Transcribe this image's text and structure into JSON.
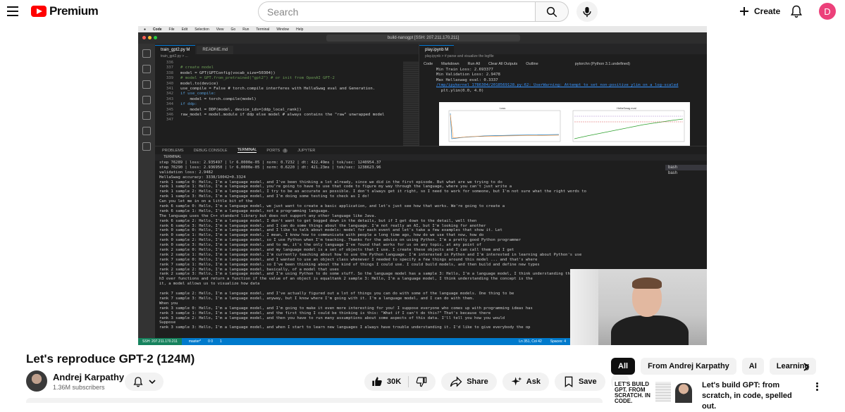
{
  "masthead": {
    "logo_text": "Premium",
    "search_placeholder": "Search",
    "create_label": "Create",
    "avatar_letter": "D",
    "colors": {
      "brand": "#ff0000",
      "avatar": "#ec407a"
    }
  },
  "video_frame": {
    "mac_menu": [
      "Code",
      "File",
      "Edit",
      "Selection",
      "View",
      "Go",
      "Run",
      "Terminal",
      "Window",
      "Help"
    ],
    "command_center": "build-nanogpt [SSH: 207.211.170.211]",
    "editor_tabs": [
      "train_gpt2.py M",
      "README.md"
    ],
    "editor_breadcrumb": "train_gpt2.py > ...",
    "code_lines": [
      {
        "n": "336",
        "t": ""
      },
      {
        "n": "337",
        "t": "# create model"
      },
      {
        "n": "338",
        "t": "model = GPT(GPTConfig(vocab_size=50304))"
      },
      {
        "n": "339",
        "t": "# model = GPT.from_pretrained(\"gpt2\") # or init from OpenAI GPT-2"
      },
      {
        "n": "340",
        "t": "model.to(device)"
      },
      {
        "n": "341",
        "t": "use_compile = False # torch.compile interferes with HellaSwag eval and Generation."
      },
      {
        "n": "342",
        "t": "if use_compile:"
      },
      {
        "n": "343",
        "t": "    model = torch.compile(model)"
      },
      {
        "n": "344",
        "t": "if ddp:"
      },
      {
        "n": "345",
        "t": "    model = DDP(model, device_ids=[ddp_local_rank])"
      },
      {
        "n": "346",
        "t": "raw_model = model.module if ddp else model # always contains the \"raw\" unwrapped model"
      },
      {
        "n": "347",
        "t": ""
      }
    ],
    "notebook_tab": "play.ipynb M",
    "notebook_breadcrumb": "play.ipynb > # parse and visualize the logfile",
    "notebook_toolbar": [
      "Code",
      "Markdown",
      "Run All",
      "Clear All Outputs",
      "Outline"
    ],
    "kernel": "pytorchn (Python 3.1.undefined)",
    "notebook_output": [
      "Min Train Loss: 2.693377",
      "Min Validation Loss: 2.9478",
      "Max Hellaswag eval: 0.3337",
      "/tmp/ipykernel_1786304/2018569128.py:62: UserWarning: Attempt to set non-positive ylim on a log-scaled",
      "  plt.ylim(0.0, 4.0)"
    ],
    "plot_titles": [
      "Loss",
      "HellaSwag eval"
    ],
    "panel_tabs": [
      "PROBLEMS",
      "DEBUG CONSOLE",
      "TERMINAL",
      "PORTS",
      "JUPYTER"
    ],
    "ports_count": "1",
    "terminal_header": "TERMINAL",
    "terminal_lines": [
      "step 76289 | loss: 2.935497 | lr 6.0000e-05 | norm: 0.7232 | dt: 422.49ms | tok/sec: 1240954.37",
      "step 76290 | loss: 2.936950 | lr 6.0000e-05 | norm: 0.6220 | dt: 421.23ms | tok/sec: 1238623.96",
      "validation loss: 2.9482",
      "HellaSwag accuracy: 3338/10042=0.3324",
      "rank 1 sample 0: Hello, I'm a language model, and I've been thinking a lot already, since we did in the first episode. But what are we trying to do",
      "rank 1 sample 1: Hello, I'm a language model, you're going to have to use that code to figure my way through the language, where you can't just write a",
      "rank 1 sample 2: Hello, I'm a language model, I try to be as accurate as possible. I don't always get it right, so I need to work for someone, but I'm not sure what the right words to",
      "rank 1 sample 3: Hello, I'm a language model, and I'm doing some testing to check as I do!",
      "Can you let me in on a little bit of the",
      "rank 6 sample 0: Hello, I'm a language model, we just want to create a basic application, and let's just see how that works. We're going to create a",
      "rank 6 sample 1: Hello, I'm a language model, not a programming language.",
      "The language uses the C++ standard library but does not support any other language like Java.",
      "rank 6 sample 2: Hello, I'm a language model, I don't want to get bogged down in the details, but if I get down to the detail, well then",
      "rank 6 sample 3: Hello, I'm a language model, and I can do some things about the language. I'm not really an AI, but I'm looking for another",
      "rank 0 sample 0: Hello, I'm a language model, and I like to talk about models: model for each event and let's take a few examples that show it. Let",
      "rank 0 sample 1: Hello, I'm a language model, I mean, I know how to communicate with people a long time ago, how do we use that now, how do",
      "rank 0 sample 2: Hello, I'm a language model, so I use Python when I'm teaching. Thanks for the advice on using Python. I'm a pretty good Python programmer",
      "rank 0 sample 3: Hello, I'm a language model, and to me, it's the only language I've found that works for us on any topic, at any point of",
      "rank 2 sample 0: Hello, I'm a language model, and my language model is a set of objects that I use. I create these objects and I can call them and I get",
      "rank 2 sample 1: Hello, I'm a language model, I'm currently teaching about how to use the Python language. I'm interested in Python and I'm interested in learning about Python's use",
      "rank 7 sample 0: Hello, I'm a language model, and I wanted to use an object class whenever I needed to specify a few things around this model ... and that's where",
      "rank 7 sample 1: Hello, I'm a language model, so I've been thinking about the kind of things I could use. I could build models, and then build and define new types",
      "rank 2 sample 2: Hello, I'm a language model, basically, of a model that uses",
      "rank 2 sample 3: Hello, I'm a language model, and I'm using Python to do some stuff. So the language model has a sample 3: Hello, I'm a language model, I think understanding the concept is the",
      "h3 over functions and return a function if the value of an object is equaltank 2 sample 3: Hello, I'm a language model, I think understanding the concept is the",
      "it, a model allows us to visualize how data",
      "",
      "rank 7 sample 2: Hello, I'm a language model, and I've actually figured out a lot of things you can do with some of the language models. One thing to be",
      "rank 7 sample 3: Hello, I'm a language model, anyway, but I know where I'm going with it. I'm a language model, and I can do with them.",
      "When you",
      "rank 3 sample 0: Hello, I'm a language model, and I'm going to make it even more interesting for you! I suppose everyone who comes up with programming ideas has",
      "rank 3 sample 1: Hello, I'm a language model, and the first thing I could be thinking is this: \"What if I can't do this?\" That's because there",
      "rank 3 sample 2: Hello, I'm a language model, and then you have to run many assumptions about some aspects of this data. I'll tell you how you would",
      "Suppose",
      "rank 3 sample 3: Hello, I'm a language model, and when I start to learn new languages I always have trouble understanding it. I'd like to give everybody the op"
    ],
    "terminal_sessions": [
      "bash",
      "bash"
    ],
    "status_remote": "SSH: 207.211.170.211",
    "status_branch": "master*",
    "status_problems": "0 0",
    "status_ports": "1",
    "status_position": "Ln 351, Col 42",
    "status_spaces": "Spaces: 4"
  },
  "video": {
    "title": "Let's reproduce GPT-2 (124M)",
    "channel_name": "Andrej Karpathy",
    "subscribers": "1.36M subscribers",
    "likes": "30K",
    "share_label": "Share",
    "ask_label": "Ask",
    "save_label": "Save"
  },
  "sidebar": {
    "chips": [
      "All",
      "From Andrej Karpathy",
      "AI",
      "Learning"
    ],
    "recommendation": {
      "title": "Let's build GPT: from scratch, in code, spelled out.",
      "thumb_text": "LET'S BUILD GPT. FROM SCRATCH. IN CODE."
    }
  }
}
